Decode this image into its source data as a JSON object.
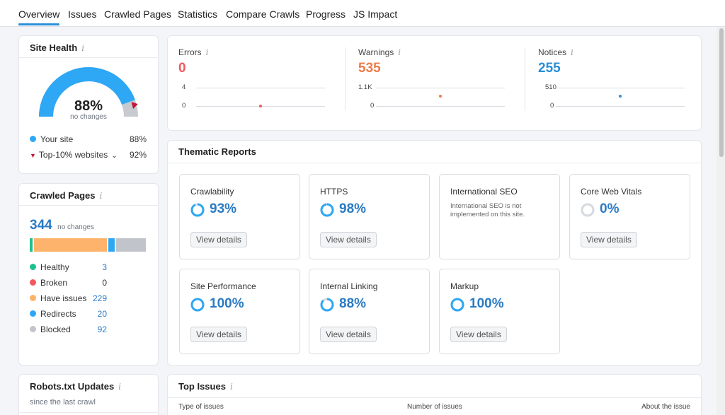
{
  "tabs": [
    "Overview",
    "Issues",
    "Crawled Pages",
    "Statistics",
    "Compare Crawls",
    "Progress",
    "JS Impact"
  ],
  "site_health": {
    "title": "Site Health",
    "percent": "88%",
    "change": "no changes",
    "your_site_label": "Your site",
    "your_site_value": "88%",
    "top_label": "Top-10% websites",
    "top_value": "92%",
    "colors": {
      "your_site": "#2ea7f5",
      "top": "#c4163b",
      "track": "#c7cacf"
    }
  },
  "crawled_pages": {
    "title": "Crawled Pages",
    "total": "344",
    "change": "no changes",
    "items": [
      {
        "label": "Healthy",
        "value": "3",
        "color": "#1fbf8f"
      },
      {
        "label": "Broken",
        "value": "0",
        "color": "#f0595e"
      },
      {
        "label": "Have issues",
        "value": "229",
        "color": "#fdb36c"
      },
      {
        "label": "Redirects",
        "value": "20",
        "color": "#2ea7f5"
      },
      {
        "label": "Blocked",
        "value": "92",
        "color": "#c1c4cb"
      }
    ]
  },
  "robots": {
    "title": "Robots.txt Updates",
    "subtitle": "since the last crawl"
  },
  "metrics": [
    {
      "label": "Errors",
      "value": "0",
      "axis_top": "4",
      "axis_bottom": "0",
      "color": "#f0595e"
    },
    {
      "label": "Warnings",
      "value": "535",
      "axis_top": "1.1K",
      "axis_bottom": "0",
      "color": "#f07c4a"
    },
    {
      "label": "Notices",
      "value": "255",
      "axis_top": "510",
      "axis_bottom": "0",
      "color": "#2a8fd8"
    }
  ],
  "thematic": {
    "title": "Thematic Reports",
    "view_label": "View details",
    "cards": [
      {
        "name": "Crawlability",
        "percent": "93%",
        "level": 0.93
      },
      {
        "name": "HTTPS",
        "percent": "98%",
        "level": 0.98
      },
      {
        "name": "International SEO",
        "note": "International SEO is not implemented on this site."
      },
      {
        "name": "Core Web Vitals",
        "percent": "0%",
        "level": 0
      },
      {
        "name": "Site Performance",
        "percent": "100%",
        "level": 1.0
      },
      {
        "name": "Internal Linking",
        "percent": "88%",
        "level": 0.88
      },
      {
        "name": "Markup",
        "percent": "100%",
        "level": 1.0
      }
    ]
  },
  "top_issues": {
    "title": "Top Issues",
    "columns": [
      "Type of issues",
      "Number of issues",
      "About the issue"
    ]
  }
}
